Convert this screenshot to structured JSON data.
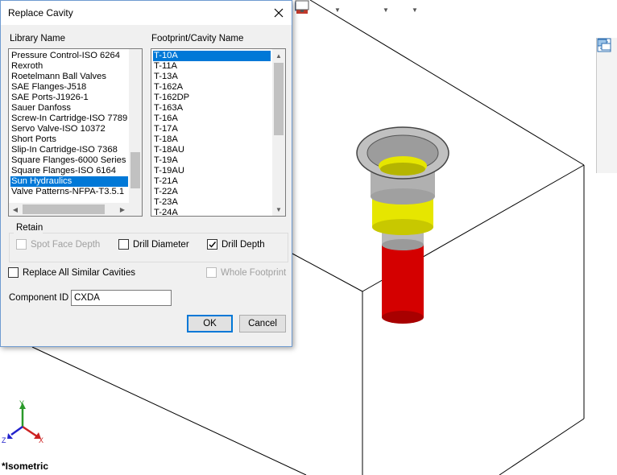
{
  "dialog": {
    "title": "Replace Cavity",
    "library_label": "Library Name",
    "footprint_label": "Footprint/Cavity Name",
    "library_items": [
      "Pressure Control-ISO 6264",
      "Rexroth",
      "Roetelmann Ball Valves",
      "SAE Flanges-J518",
      "SAE Ports-J1926-1",
      "Sauer Danfoss",
      "Screw-In Cartridge-ISO 7789",
      "Servo Valve-ISO 10372",
      "Short Ports",
      "Slip-In Cartridge-ISO 7368",
      "Square Flanges-6000 Series",
      "Square Flanges-ISO 6164",
      "Sun Hydraulics",
      "Valve Patterns-NFPA-T3.5.1"
    ],
    "library_selected": "Sun Hydraulics",
    "footprint_items": [
      "T-10A",
      "T-11A",
      "T-13A",
      "T-162A",
      "T-162DP",
      "T-163A",
      "T-16A",
      "T-17A",
      "T-18A",
      "T-18AU",
      "T-19A",
      "T-19AU",
      "T-21A",
      "T-22A",
      "T-23A",
      "T-24A"
    ],
    "footprint_selected": "T-10A",
    "retain_label": "Retain",
    "spot_face_label": "Spot Face Depth",
    "spot_face_checked": false,
    "drill_diameter_label": "Drill Diameter",
    "drill_diameter_checked": false,
    "drill_depth_label": "Drill Depth",
    "drill_depth_checked": true,
    "replace_all_label": "Replace All Similar Cavities",
    "replace_all_checked": false,
    "whole_footprint_label": "Whole Footprint",
    "whole_footprint_checked": false,
    "component_id_label": "Component ID",
    "component_id_value": "CXDA",
    "ok_label": "OK",
    "cancel_label": "Cancel"
  },
  "viewport": {
    "view_name": "*Isometric",
    "triad_labels": {
      "x": "X",
      "y": "Y",
      "z": "Z"
    }
  },
  "icons": {
    "toolbar": [
      "hide-show-icon",
      "edit-appearance-icon",
      "apply-scene-icon",
      "view-settings-icon"
    ],
    "taskpane": [
      "home-icon",
      "design-library-icon",
      "file-explorer-icon",
      "view-palette-icon",
      "appearances-icon",
      "custom-properties-icon",
      "forum-icon"
    ]
  },
  "colors": {
    "selection": "#0078d7",
    "cavity_red": "#d40000",
    "cavity_yellow": "#e6e600",
    "cavity_gray": "#b0b0b0"
  }
}
